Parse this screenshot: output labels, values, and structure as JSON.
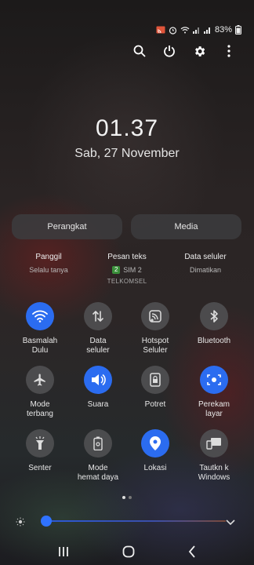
{
  "status_bar": {
    "battery_percent": "83%",
    "icons": [
      "cast-icon",
      "alarm-icon",
      "wifi-icon",
      "signal-icon",
      "signal-icon",
      "battery-icon"
    ]
  },
  "top_actions": [
    "search-icon",
    "power-icon",
    "gear-icon",
    "more-icon"
  ],
  "clock": {
    "time": "01.37",
    "date": "Sab, 27 November"
  },
  "pills": {
    "devices": "Perangkat",
    "media": "Media"
  },
  "info": [
    {
      "title": "Panggil",
      "sub": "Selalu tanya"
    },
    {
      "title": "Pesan teks",
      "sim_badge": "2",
      "sub": "SIM 2",
      "sub2": "TELKOMSEL"
    },
    {
      "title": "Data seluler",
      "sub": "Dimatikan"
    }
  ],
  "tiles": [
    {
      "label": "Basmalah\nDulu",
      "icon": "wifi-icon",
      "on": true
    },
    {
      "label": "Data\nseluler",
      "icon": "data-arrows-icon",
      "on": false
    },
    {
      "label": "Hotspot\nSeluler",
      "icon": "hotspot-icon",
      "on": false
    },
    {
      "label": "Bluetooth",
      "icon": "bluetooth-icon",
      "on": false
    },
    {
      "label": "Mode\nterbang",
      "icon": "airplane-icon",
      "on": false
    },
    {
      "label": "Suara",
      "icon": "speaker-icon",
      "on": true
    },
    {
      "label": "Potret",
      "icon": "rotation-lock-icon",
      "on": false
    },
    {
      "label": "Perekam\nlayar",
      "icon": "screen-record-icon",
      "on": true
    },
    {
      "label": "Senter",
      "icon": "flashlight-icon",
      "on": false
    },
    {
      "label": "Mode\nhemat daya",
      "icon": "power-saving-icon",
      "on": false
    },
    {
      "label": "Lokasi",
      "icon": "location-icon",
      "on": true
    },
    {
      "label": "Tautkn k\nWindows",
      "icon": "link-windows-icon",
      "on": false
    }
  ],
  "brightness": {
    "level": 0.05
  },
  "colors": {
    "accent": "#2b6cf0",
    "tile_off": "#505052"
  }
}
